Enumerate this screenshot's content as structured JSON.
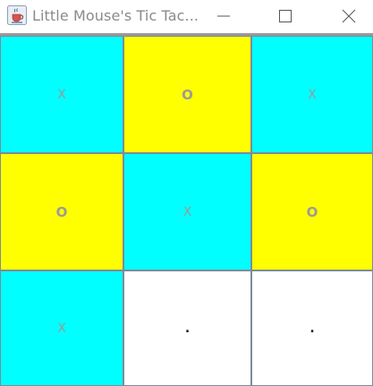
{
  "window": {
    "title": "Little Mouse's Tic Tac...",
    "icon": "java-cup-icon",
    "controls": {
      "minimize": "minimize-icon",
      "maximize": "maximize-icon",
      "close": "close-icon"
    }
  },
  "board": {
    "colors": {
      "cyan": "#00FFFF",
      "yellow": "#FFFF00",
      "white": "#FFFFFF",
      "mark": "#9A9A9A"
    },
    "cells": [
      {
        "mark": "X",
        "color": "cyan"
      },
      {
        "mark": "O",
        "color": "yellow"
      },
      {
        "mark": "X",
        "color": "cyan"
      },
      {
        "mark": "O",
        "color": "yellow"
      },
      {
        "mark": "X",
        "color": "cyan"
      },
      {
        "mark": "O",
        "color": "yellow"
      },
      {
        "mark": "X",
        "color": "cyan"
      },
      {
        "mark": ".",
        "color": "white"
      },
      {
        "mark": ".",
        "color": "white"
      }
    ]
  }
}
